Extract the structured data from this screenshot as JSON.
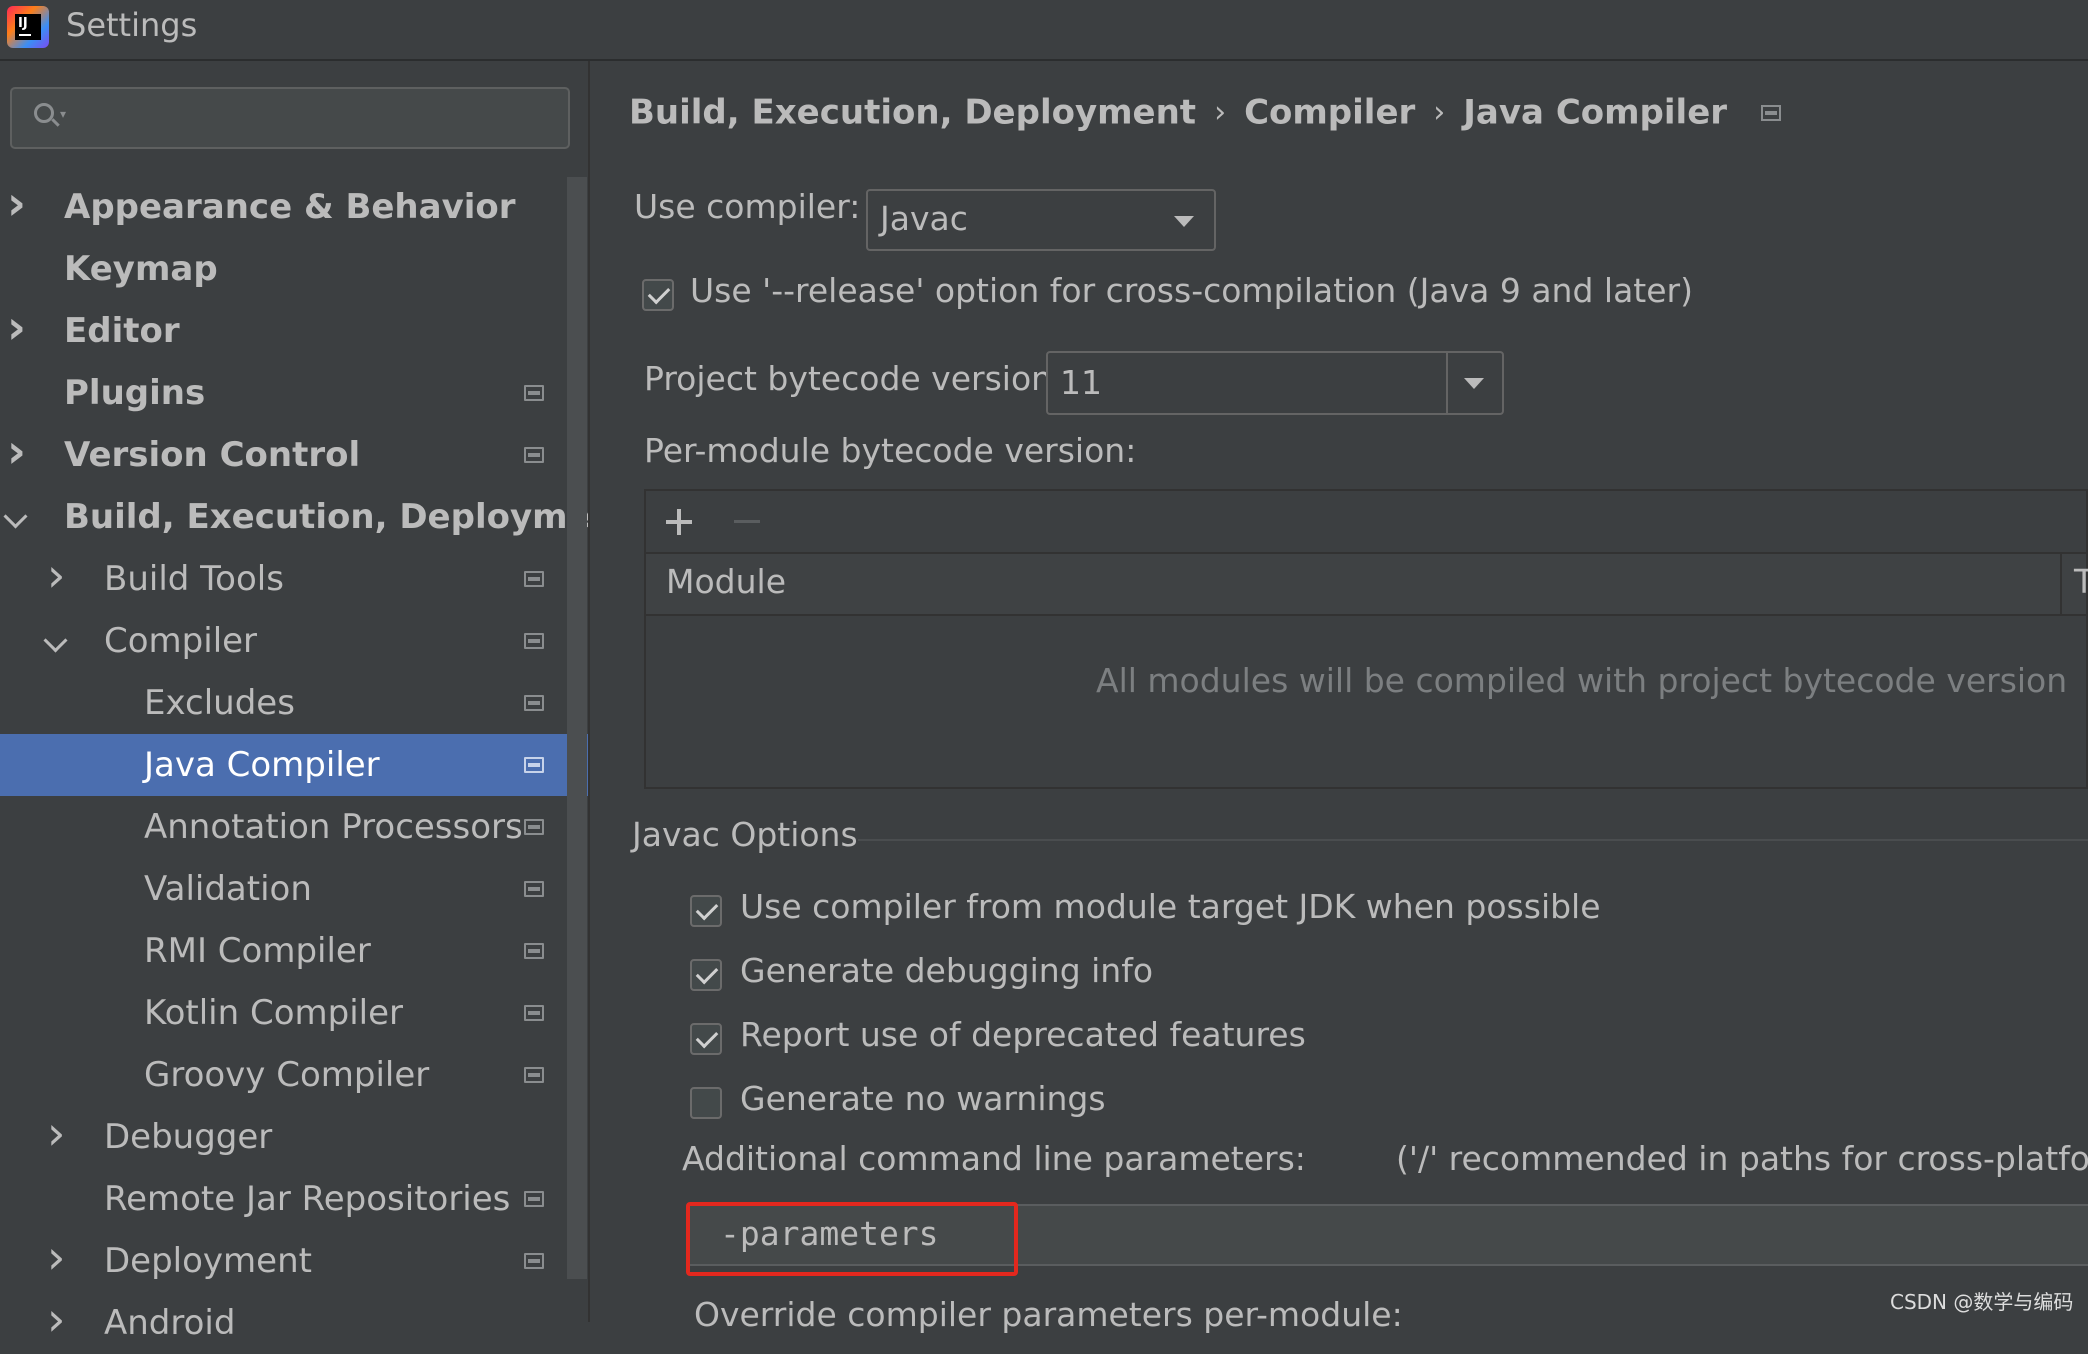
{
  "window": {
    "title": "Settings"
  },
  "sidebar": {
    "search_placeholder": "",
    "items": [
      {
        "label": "Appearance & Behavior",
        "expander": "right",
        "level": 0,
        "bold": true,
        "project_icon": false
      },
      {
        "label": "Keymap",
        "expander": "none",
        "level": 0,
        "bold": true,
        "project_icon": false
      },
      {
        "label": "Editor",
        "expander": "right",
        "level": 0,
        "bold": true,
        "project_icon": false
      },
      {
        "label": "Plugins",
        "expander": "none",
        "level": 0,
        "bold": true,
        "project_icon": true
      },
      {
        "label": "Version Control",
        "expander": "right",
        "level": 0,
        "bold": true,
        "project_icon": true
      },
      {
        "label": "Build, Execution, Deployment",
        "expander": "down",
        "level": 0,
        "bold": true,
        "project_icon": false
      },
      {
        "label": "Build Tools",
        "expander": "right",
        "level": 1,
        "bold": false,
        "project_icon": true
      },
      {
        "label": "Compiler",
        "expander": "down",
        "level": 1,
        "bold": false,
        "project_icon": true
      },
      {
        "label": "Excludes",
        "expander": "none",
        "level": 2,
        "bold": false,
        "project_icon": true
      },
      {
        "label": "Java Compiler",
        "expander": "none",
        "level": 2,
        "bold": false,
        "project_icon": true,
        "selected": true
      },
      {
        "label": "Annotation Processors",
        "expander": "none",
        "level": 2,
        "bold": false,
        "project_icon": true
      },
      {
        "label": "Validation",
        "expander": "none",
        "level": 2,
        "bold": false,
        "project_icon": true
      },
      {
        "label": "RMI Compiler",
        "expander": "none",
        "level": 2,
        "bold": false,
        "project_icon": true
      },
      {
        "label": "Kotlin Compiler",
        "expander": "none",
        "level": 2,
        "bold": false,
        "project_icon": true
      },
      {
        "label": "Groovy Compiler",
        "expander": "none",
        "level": 2,
        "bold": false,
        "project_icon": true
      },
      {
        "label": "Debugger",
        "expander": "right",
        "level": 1,
        "bold": false,
        "project_icon": false
      },
      {
        "label": "Remote Jar Repositories",
        "expander": "none",
        "level": 1,
        "bold": false,
        "project_icon": true
      },
      {
        "label": "Deployment",
        "expander": "right",
        "level": 1,
        "bold": false,
        "project_icon": true
      },
      {
        "label": "Android",
        "expander": "right",
        "level": 1,
        "bold": false,
        "project_icon": false
      }
    ]
  },
  "breadcrumb": {
    "items": [
      "Build, Execution, Deployment",
      "Compiler",
      "Java Compiler"
    ],
    "separator": "›"
  },
  "compiler": {
    "use_compiler_label": "Use compiler:",
    "use_compiler_value": "Javac",
    "release_option_label": "Use '--release' option for cross-compilation (Java 9 and later)",
    "release_option_checked": true,
    "project_bytecode_label": "Project bytecode version:",
    "project_bytecode_value": "11",
    "per_module_label": "Per-module bytecode version:",
    "table": {
      "column_module": "Module",
      "column_target": "T",
      "empty_text": "All modules will be compiled with project bytecode version"
    }
  },
  "javac_options": {
    "group_title": "Javac Options",
    "checkboxes": [
      {
        "label": "Use compiler from module target JDK when possible",
        "checked": true
      },
      {
        "label": "Generate debugging info",
        "checked": true
      },
      {
        "label": "Report use of deprecated features",
        "checked": true
      },
      {
        "label": "Generate no warnings",
        "checked": false
      }
    ],
    "additional_params_label": "Additional command line parameters:",
    "additional_params_hint": "('/' recommended in paths for cross-platform",
    "additional_params_value": "-parameters",
    "override_label": "Override compiler parameters per-module:"
  },
  "watermark": "CSDN @数学与编码",
  "colors": {
    "background": "#3c3f41",
    "selection": "#4b6eaf",
    "highlight_box": "#e3281e"
  }
}
